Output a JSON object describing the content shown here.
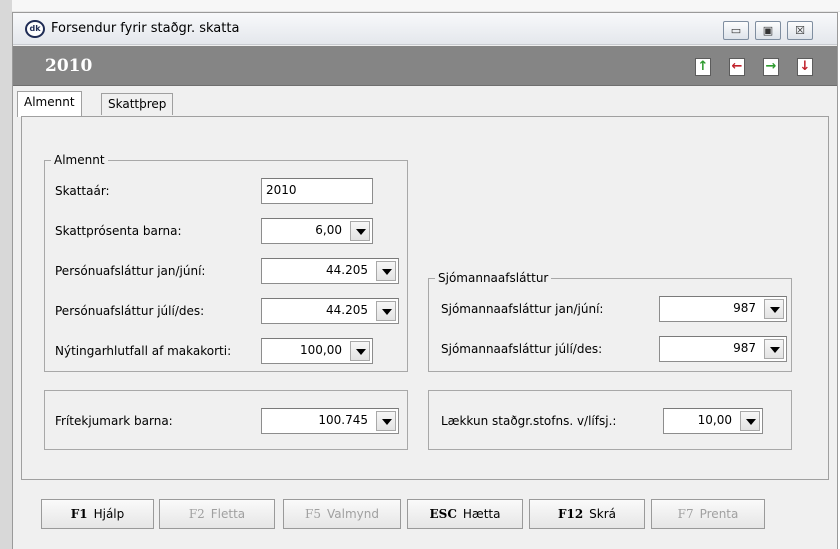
{
  "window": {
    "title": "Forsendur fyrir staðgr. skatta",
    "icon_text": "dk",
    "controls": {
      "minimize": "▭",
      "maximize": "▣",
      "close": "☒"
    }
  },
  "header": {
    "year": "2010",
    "icons": [
      "export-up-icon",
      "import-left-icon",
      "export-right-icon",
      "import-down-icon"
    ],
    "icon_colors": {
      "green": "#2e9b2e",
      "red": "#c0202a",
      "accent": "#858585"
    }
  },
  "tabs": [
    {
      "label": "Almennt",
      "active": true
    },
    {
      "label": "Skattþrep",
      "active": false
    }
  ],
  "almennt": {
    "title": "Almennt",
    "fields": [
      {
        "label": "Skattaár:",
        "value": "2010"
      },
      {
        "label": "Skattprósenta barna:",
        "value": "6,00"
      },
      {
        "label": "Persónuafsláttur jan/júní:",
        "value": "44.205"
      },
      {
        "label": "Persónuafsláttur júlí/des:",
        "value": "44.205"
      },
      {
        "label": "Nýtingarhlutfall af makakorti:",
        "value": "100,00"
      }
    ]
  },
  "sjomanna": {
    "title": "Sjómannaafsláttur",
    "fields": [
      {
        "label": "Sjómannaafsláttur jan/júní:",
        "value": "987"
      },
      {
        "label": "Sjómannaafsláttur júlí/des:",
        "value": "987"
      }
    ]
  },
  "fritekjumark": {
    "label": "Frítekjumark barna:",
    "value": "100.745"
  },
  "laekkun": {
    "label": "Lækkun staðgr.stofns. v/lífsj.:",
    "value": "10,00"
  },
  "buttons": [
    {
      "key": "F1",
      "label": "Hjálp",
      "enabled": true
    },
    {
      "key": "F2",
      "label": "Fletta",
      "enabled": false
    },
    {
      "key": "F5",
      "label": "Valmynd",
      "enabled": false
    },
    {
      "key": "ESC",
      "label": "Hætta",
      "enabled": true
    },
    {
      "key": "F12",
      "label": "Skrá",
      "enabled": true
    },
    {
      "key": "F7",
      "label": "Prenta",
      "enabled": false
    }
  ]
}
